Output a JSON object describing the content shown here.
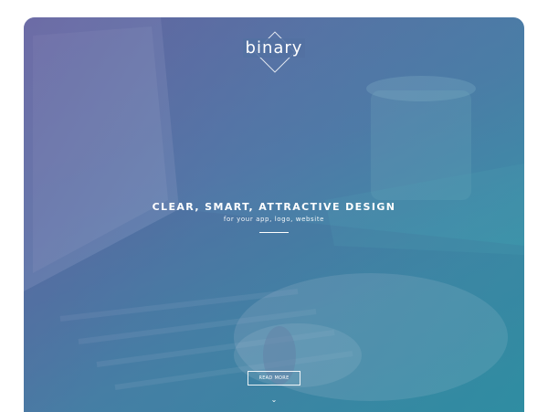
{
  "logo": {
    "text": "binary",
    "icon": "diamond-outline-icon"
  },
  "hero": {
    "headline": "CLEAR, SMART, ATTRACTIVE DESIGN",
    "subheadline": "for your app, logo, website"
  },
  "cta": {
    "read_more_label": "READ MORE"
  },
  "scroll": {
    "icon": "chevron-down-icon",
    "glyph": "⌄"
  },
  "colors": {
    "gradient_start": "#6d5aa0",
    "gradient_end": "#2e96a6",
    "text": "#ffffff"
  }
}
